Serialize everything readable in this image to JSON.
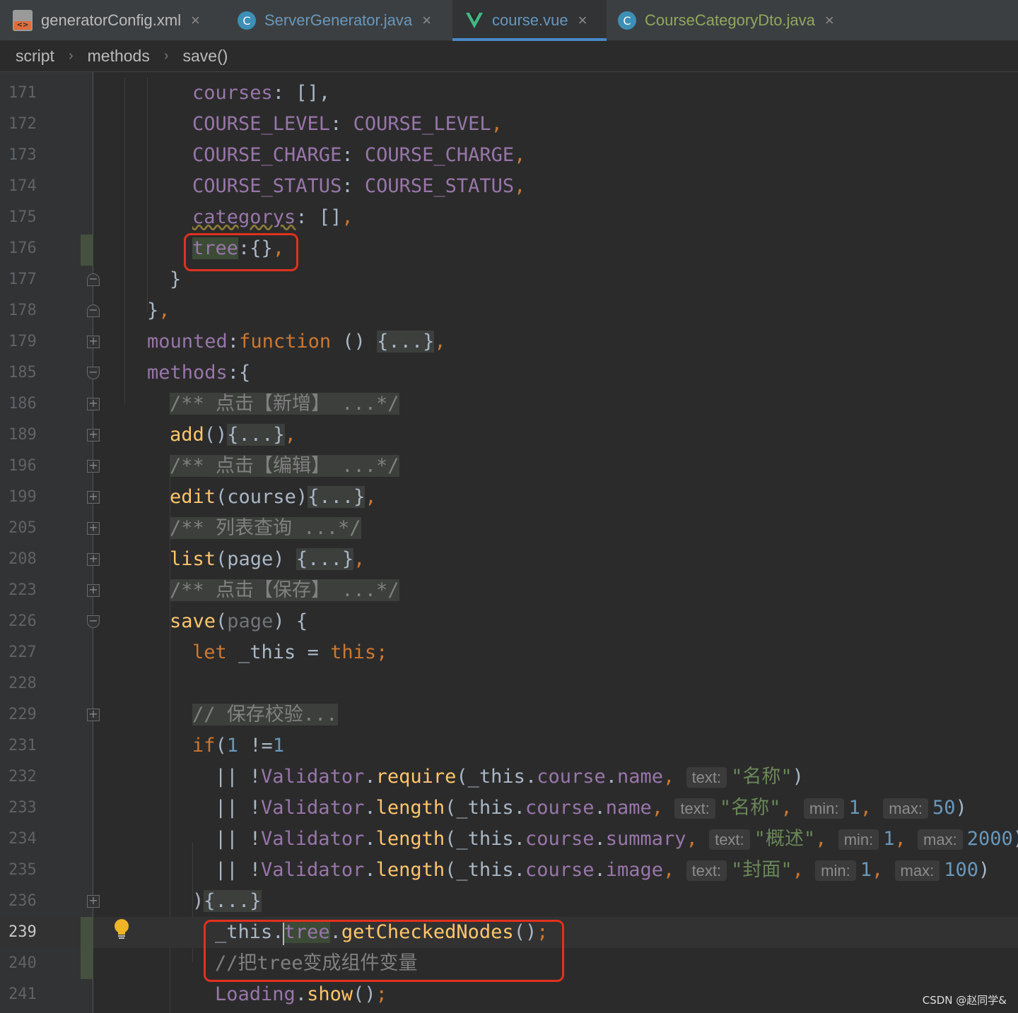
{
  "tabs": [
    {
      "label": "generatorConfig.xml",
      "icon": "xml-file-icon",
      "color": "#bbbbbb",
      "active": false
    },
    {
      "label": "ServerGenerator.java",
      "icon": "java-class-icon",
      "color": "#6897bb",
      "active": false
    },
    {
      "label": "course.vue",
      "icon": "vue-file-icon",
      "color": "#6897bb",
      "active": true
    },
    {
      "label": "CourseCategoryDto.java",
      "icon": "java-class-icon",
      "color": "#8fa85e",
      "active": false
    }
  ],
  "breadcrumb": [
    "script",
    "methods",
    "save()"
  ],
  "lines": [
    {
      "no": "171",
      "fold": "",
      "segs": [
        [
          "f",
          "courses"
        ],
        [
          "b",
          ": [],"
        ]
      ]
    },
    {
      "no": "172",
      "fold": "",
      "segs": [
        [
          "f",
          "COURSE_LEVEL"
        ],
        [
          "b",
          ": "
        ],
        [
          "f",
          "COURSE_LEVEL"
        ],
        [
          "k",
          ","
        ]
      ]
    },
    {
      "no": "173",
      "fold": "",
      "segs": [
        [
          "f",
          "COURSE_CHARGE"
        ],
        [
          "b",
          ": "
        ],
        [
          "f",
          "COURSE_CHARGE"
        ],
        [
          "k",
          ","
        ]
      ]
    },
    {
      "no": "174",
      "fold": "",
      "segs": [
        [
          "f",
          "COURSE_STATUS"
        ],
        [
          "b",
          ": "
        ],
        [
          "f",
          "COURSE_STATUS"
        ],
        [
          "k",
          ","
        ]
      ]
    },
    {
      "no": "175",
      "fold": "",
      "segs": [
        [
          "f sq",
          "categorys"
        ],
        [
          "b",
          ": []"
        ],
        [
          "k",
          ","
        ]
      ]
    },
    {
      "no": "176",
      "fold": "",
      "segs": [
        [
          "f hl",
          "tree"
        ],
        [
          "b",
          ":{}"
        ],
        [
          "k",
          ","
        ]
      ]
    },
    {
      "no": "177",
      "fold": "end",
      "segs": [
        [
          "b",
          "}"
        ]
      ]
    },
    {
      "no": "178",
      "fold": "end",
      "segs": [
        [
          "b",
          "}"
        ],
        [
          "k",
          ","
        ]
      ]
    },
    {
      "no": "179",
      "fold": "plus",
      "segs": [
        [
          "f",
          "mounted"
        ],
        [
          "b",
          ":"
        ],
        [
          "k",
          "function"
        ],
        [
          "b",
          " () "
        ],
        [
          "b fb",
          "{...}"
        ],
        [
          "k",
          ","
        ]
      ]
    },
    {
      "no": "185",
      "fold": "minus",
      "segs": [
        [
          "f",
          "methods"
        ],
        [
          "b",
          ":{"
        ]
      ]
    },
    {
      "no": "186",
      "fold": "plus",
      "segs": [
        [
          "c fb",
          "/** 点击【新增】 ...*/"
        ]
      ]
    },
    {
      "no": "189",
      "fold": "plus",
      "segs": [
        [
          "m",
          "add"
        ],
        [
          "b",
          "()"
        ],
        [
          "b fb",
          "{...}"
        ],
        [
          "k",
          ","
        ]
      ]
    },
    {
      "no": "196",
      "fold": "plus",
      "segs": [
        [
          "c fb",
          "/** 点击【编辑】 ...*/"
        ]
      ]
    },
    {
      "no": "199",
      "fold": "plus",
      "segs": [
        [
          "m",
          "edit"
        ],
        [
          "b",
          "(course)"
        ],
        [
          "b fb",
          "{...}"
        ],
        [
          "k",
          ","
        ]
      ]
    },
    {
      "no": "205",
      "fold": "plus",
      "segs": [
        [
          "c fb",
          "/** 列表查询 ...*/"
        ]
      ]
    },
    {
      "no": "208",
      "fold": "plus",
      "segs": [
        [
          "m",
          "list"
        ],
        [
          "b",
          "(page) "
        ],
        [
          "b fb",
          "{...}"
        ],
        [
          "k",
          ","
        ]
      ]
    },
    {
      "no": "223",
      "fold": "plus",
      "segs": [
        [
          "c fb",
          "/** 点击【保存】 ...*/"
        ]
      ]
    },
    {
      "no": "226",
      "fold": "minus",
      "segs": [
        [
          "m",
          "save"
        ],
        [
          "b",
          "("
        ],
        [
          "u",
          "page"
        ],
        [
          "b",
          ") {"
        ]
      ]
    },
    {
      "no": "227",
      "fold": "",
      "segs": [
        [
          "k",
          "let"
        ],
        [
          "b",
          " _this = "
        ],
        [
          "k",
          "this;"
        ]
      ]
    },
    {
      "no": "228",
      "fold": "",
      "segs": []
    },
    {
      "no": "229",
      "fold": "plus",
      "segs": [
        [
          "c fb",
          "// 保存校验..."
        ]
      ]
    },
    {
      "no": "231",
      "fold": "",
      "segs": [
        [
          "k",
          "if"
        ],
        [
          "b",
          "("
        ],
        [
          "n",
          "1"
        ],
        [
          "b",
          " !="
        ],
        [
          "n",
          "1"
        ]
      ]
    },
    {
      "no": "232",
      "fold": "",
      "segs": [
        [
          "b",
          "|| !"
        ],
        [
          "f",
          "Validator"
        ],
        [
          "b",
          "."
        ],
        [
          "m",
          "require"
        ],
        [
          "b",
          "(_this."
        ],
        [
          "f",
          "course"
        ],
        [
          "b",
          "."
        ],
        [
          "f",
          "name"
        ],
        [
          "k",
          ", "
        ],
        [
          "hint",
          "text:"
        ],
        [
          "s",
          "\"名称\""
        ],
        [
          "b",
          ")"
        ]
      ]
    },
    {
      "no": "233",
      "fold": "",
      "segs": [
        [
          "b",
          "|| !"
        ],
        [
          "f",
          "Validator"
        ],
        [
          "b",
          "."
        ],
        [
          "m",
          "length"
        ],
        [
          "b",
          "(_this."
        ],
        [
          "f",
          "course"
        ],
        [
          "b",
          "."
        ],
        [
          "f",
          "name"
        ],
        [
          "k",
          ", "
        ],
        [
          "hint",
          "text:"
        ],
        [
          "s",
          "\"名称\""
        ],
        [
          "k",
          ", "
        ],
        [
          "hint",
          "min:"
        ],
        [
          "n",
          "1"
        ],
        [
          "k",
          ", "
        ],
        [
          "hint",
          "max:"
        ],
        [
          "n",
          "50"
        ],
        [
          "b",
          ")"
        ]
      ]
    },
    {
      "no": "234",
      "fold": "",
      "segs": [
        [
          "b",
          "|| !"
        ],
        [
          "f",
          "Validator"
        ],
        [
          "b",
          "."
        ],
        [
          "m",
          "length"
        ],
        [
          "b",
          "(_this."
        ],
        [
          "f",
          "course"
        ],
        [
          "b",
          "."
        ],
        [
          "f",
          "summary"
        ],
        [
          "k",
          ", "
        ],
        [
          "hint",
          "text:"
        ],
        [
          "s",
          "\"概述\""
        ],
        [
          "k",
          ", "
        ],
        [
          "hint",
          "min:"
        ],
        [
          "n",
          "1"
        ],
        [
          "k",
          ", "
        ],
        [
          "hint",
          "max:"
        ],
        [
          "n",
          "2000"
        ],
        [
          "b",
          ")"
        ]
      ]
    },
    {
      "no": "235",
      "fold": "",
      "segs": [
        [
          "b",
          "|| !"
        ],
        [
          "f",
          "Validator"
        ],
        [
          "b",
          "."
        ],
        [
          "m",
          "length"
        ],
        [
          "b",
          "(_this."
        ],
        [
          "f",
          "course"
        ],
        [
          "b",
          "."
        ],
        [
          "f",
          "image"
        ],
        [
          "k",
          ", "
        ],
        [
          "hint",
          "text:"
        ],
        [
          "s",
          "\"封面\""
        ],
        [
          "k",
          ", "
        ],
        [
          "hint",
          "min:"
        ],
        [
          "n",
          "1"
        ],
        [
          "k",
          ", "
        ],
        [
          "hint",
          "max:"
        ],
        [
          "n",
          "100"
        ],
        [
          "b",
          ")"
        ]
      ]
    },
    {
      "no": "236",
      "fold": "plus",
      "segs": [
        [
          "b",
          ")"
        ],
        [
          "b fb",
          "{...}"
        ]
      ]
    },
    {
      "no": "239",
      "fold": "",
      "segs": [
        [
          "b",
          "_this."
        ],
        [
          "f hl",
          "tree"
        ],
        [
          "b",
          "."
        ],
        [
          "m",
          "getCheckedNodes"
        ],
        [
          "b",
          "()"
        ],
        [
          "k",
          ";"
        ]
      ]
    },
    {
      "no": "240",
      "fold": "",
      "segs": [
        [
          "c",
          "//把tree变成组件变量"
        ]
      ]
    },
    {
      "no": "241",
      "fold": "",
      "segs": [
        [
          "f",
          "Loading"
        ],
        [
          "b",
          "."
        ],
        [
          "m",
          "show"
        ],
        [
          "b",
          "()"
        ],
        [
          "k",
          ";"
        ]
      ]
    }
  ],
  "watermark": "CSDN @赵同学&",
  "colors": {
    "accent": "#4a88c7",
    "highlight_box": "#e0311f",
    "keyword": "#cc7832",
    "field": "#9876aa",
    "method": "#ffc66d",
    "string": "#6a8759",
    "number": "#6897bb",
    "comment": "#808080"
  }
}
